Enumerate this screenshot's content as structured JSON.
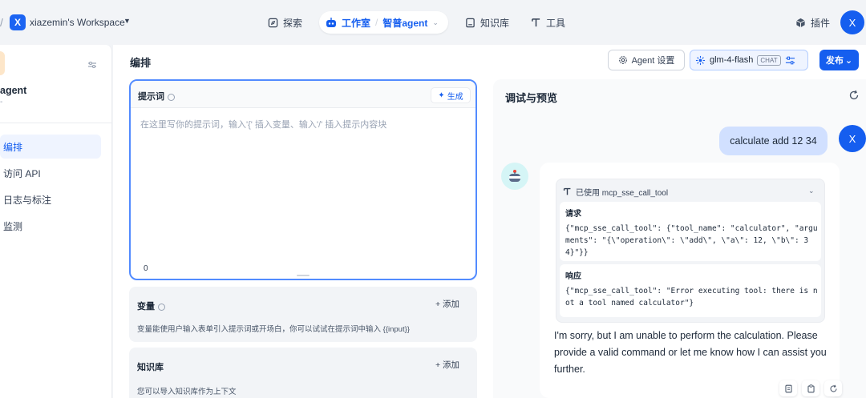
{
  "topbar": {
    "workspace_initial": "X",
    "workspace_name": "xiazemin's Workspace",
    "nav": {
      "explore": "探索",
      "studio": "工作室",
      "agent": "智普agent",
      "knowledge": "知识库",
      "tools": "工具",
      "plugins": "插件"
    },
    "user_initial": "X"
  },
  "sidebar": {
    "app_name": "agent",
    "app_sub": "-",
    "items": [
      {
        "label": "编排",
        "active": true
      },
      {
        "label": "访问 API",
        "active": false
      },
      {
        "label": "日志与标注",
        "active": false
      },
      {
        "label": "监测",
        "active": false
      }
    ]
  },
  "editor": {
    "title": "编排",
    "agent_settings": "Agent 设置",
    "model_name": "glm-4-flash",
    "model_badge": "CHAT",
    "publish": "发布",
    "prompt": {
      "label": "提示词",
      "generate": "生成",
      "placeholder": "在这里写你的提示词，输入'{' 插入变量、输入'/' 插入提示内容块",
      "count": "0"
    },
    "variables": {
      "title": "变量",
      "add": "+ 添加",
      "desc": "变量能使用户输入表单引入提示词或开场白，你可以试试在提示词中输入 {{input}}"
    },
    "knowledge": {
      "title": "知识库",
      "add": "+ 添加",
      "desc": "您可以导入知识库作为上下文"
    }
  },
  "preview": {
    "title": "调试与预览",
    "user_message": "calculate add 12 34",
    "user_initial": "X",
    "tool": {
      "header": "已使用 mcp_sse_call_tool",
      "request_label": "请求",
      "request_body": "{\"mcp_sse_call_tool\": {\"tool_name\": \"calculator\", \"arguments\": \"{\\\"operation\\\": \\\"add\\\", \\\"a\\\": 12, \\\"b\\\": 34}\"}}",
      "response_label": "响应",
      "response_body": "{\"mcp_sse_call_tool\": \"Error executing tool: there is not a tool named calculator\"}"
    },
    "answer": "I'm sorry, but I am unable to perform the calculation. Please provide a valid command or let me know how I can assist you further."
  },
  "colors": {
    "accent": "#155eef",
    "user_bubble": "#d1e0ff",
    "page_bg": "#f2f4f7"
  }
}
